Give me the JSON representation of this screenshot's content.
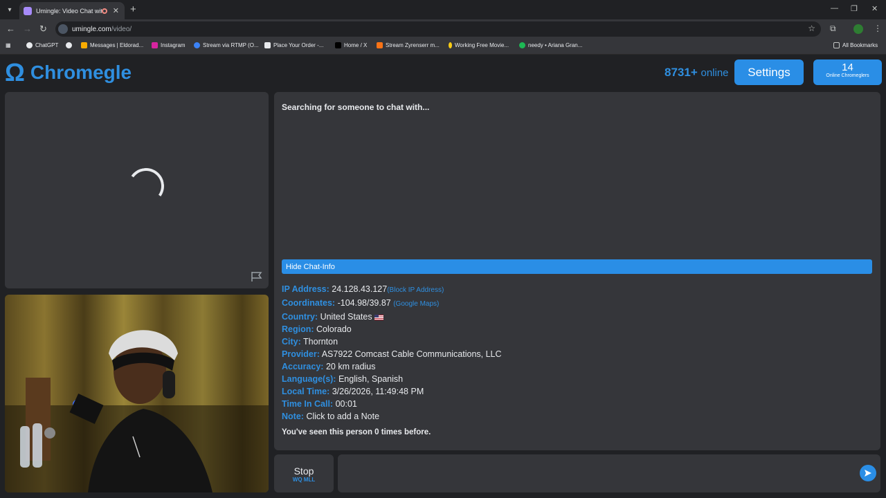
{
  "browser": {
    "tab_title": "Umingle: Video Chat with S",
    "url_host": "umingle.com",
    "url_path": "/video/",
    "bookmarks": [
      "ChatGPT",
      "Messages | Eldorad...",
      "Instagram",
      "Stream via RTMP (O...",
      "Place Your Order -...",
      "Home / X",
      "Stream Zyrenserr m...",
      "Working Free Movie...",
      "needy • Ariana Gran..."
    ],
    "all_bookmarks": "All Bookmarks"
  },
  "header": {
    "logo_symbol": "Ω",
    "logo_text": "Chromegle",
    "online_count": "8731+",
    "online_label": "online",
    "settings_label": "Settings",
    "chromeglers_count": "14",
    "chromeglers_label": "Online Chromeglers"
  },
  "chat": {
    "status": "Searching for someone to chat with...",
    "hide_info_label": "Hide Chat-Info",
    "info": {
      "ip_key": "IP Address:",
      "ip": "24.128.43.127",
      "ip_link": "(Block IP Address)",
      "coord_key": "Coordinates:",
      "coord": "-104.98/39.87",
      "coord_link": "(Google Maps)",
      "country_key": "Country:",
      "country": "United States",
      "region_key": "Region:",
      "region": "Colorado",
      "city_key": "City:",
      "city": "Thornton",
      "provider_key": "Provider:",
      "provider": "AS7922 Comcast Cable Communications, LLC",
      "accuracy_key": "Accuracy:",
      "accuracy": "20 km radius",
      "lang_key": "Language(s):",
      "lang": "English, Spanish",
      "time_key": "Local Time:",
      "time": "3/26/2026, 11:49:48 PM",
      "incall_key": "Time In Call:",
      "incall": "00:01",
      "note_key": "Note:",
      "note": "Click to add a Note"
    },
    "seen_text": "You've seen this person 0 times before.",
    "stop_label": "Stop",
    "stop_hint": "WQ MLL"
  },
  "colors": {
    "accent": "#2a8ee6",
    "panel": "#35363a",
    "bg": "#202124"
  }
}
